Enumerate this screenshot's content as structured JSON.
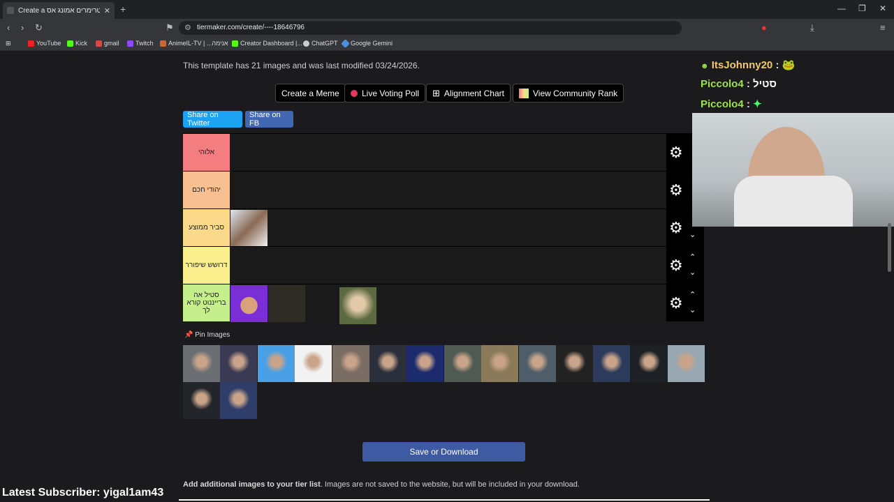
{
  "browser": {
    "tab_title": "Create a רוג סטרימרים אמונג אס",
    "url": "tiermaker.com/create/----18646796",
    "bookmarks": [
      "YouTube",
      "Kick",
      "gmail",
      "Twitch",
      "AnimeIL-TV | ...אנימה",
      "Creator Dashboard |...",
      "ChatGPT",
      "Google Gemini"
    ]
  },
  "page": {
    "info": "This template has 21 images and was last modified 03/24/2026.",
    "buttons": {
      "create_meme": "Create a Meme",
      "live_poll": "Live Voting Poll",
      "alignment": "Alignment Chart",
      "community_rank": "View Community Rank"
    },
    "share": {
      "twitter": "Share on Twitter",
      "fb": "Share on FB"
    },
    "tiers": [
      {
        "label": "אלוהי",
        "color": "#f47d7f"
      },
      {
        "label": "יהודי חכם",
        "color": "#f8c090"
      },
      {
        "label": "סביר ממוצע",
        "color": "#fad98b"
      },
      {
        "label": "דרושש שיפורר",
        "color": "#fbef8d"
      },
      {
        "label": "סטיל אה ברייננוט קורא לך",
        "color": "#c5ef8a"
      }
    ],
    "pin_label": "Pin Images",
    "save_label": "Save or Download",
    "add_bold": "Add additional images to your tier list",
    "add_rest": ". Images are not saved to the website, but will be included in your download."
  },
  "stream": {
    "latest_sub": "Latest Subscriber: yigal1am43",
    "chat": [
      {
        "user": "ItsJohnny20",
        "msg": ""
      },
      {
        "user": "Piccolo4",
        "msg": "סטיל"
      },
      {
        "user": "Piccolo4",
        "msg": ""
      }
    ]
  },
  "colors": {
    "twitter": "#1da1f2",
    "fb": "#4267b2",
    "save": "#3e5aa3"
  }
}
